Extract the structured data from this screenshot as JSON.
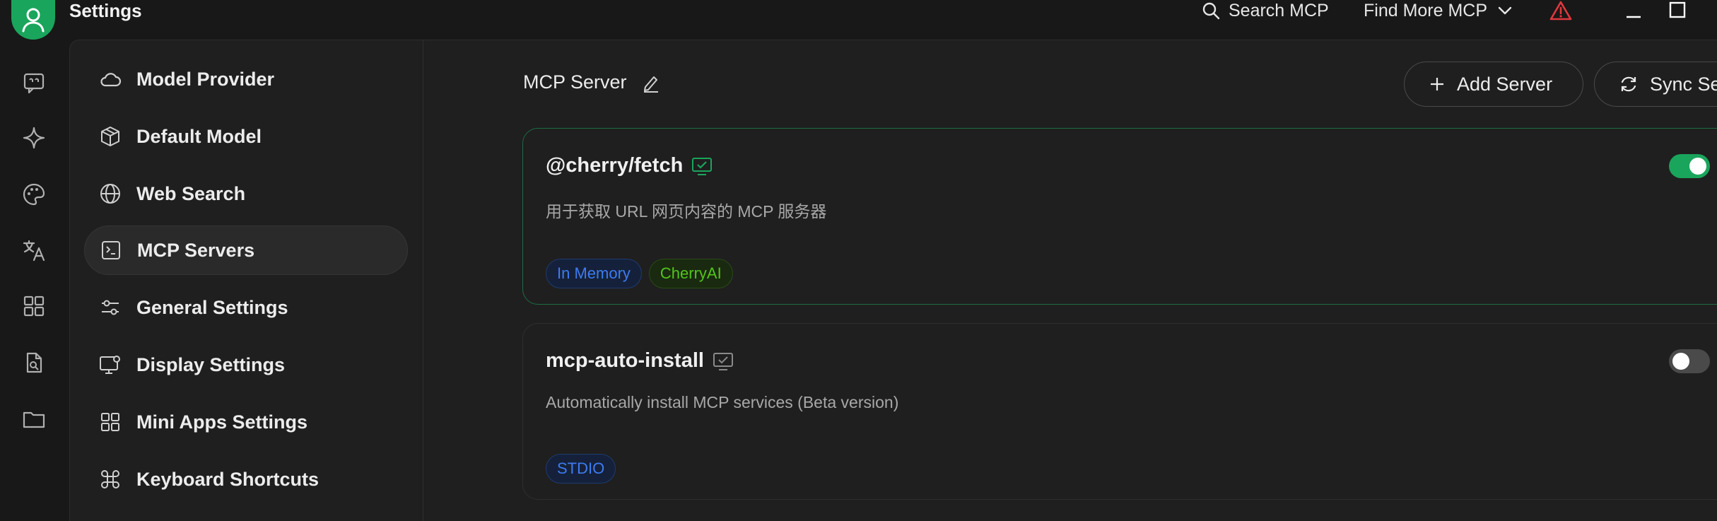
{
  "window": {
    "title": "Settings"
  },
  "topbar": {
    "search_label": "Search MCP",
    "find_more_label": "Find More MCP"
  },
  "rail": {
    "icons": [
      "chat-icon",
      "sparkle-icon",
      "palette-icon",
      "translate-icon",
      "apps-icon",
      "file-search-icon",
      "folder-icon"
    ]
  },
  "nav": {
    "items": [
      {
        "label": "Model Provider",
        "icon": "cloud-icon"
      },
      {
        "label": "Default Model",
        "icon": "cube-icon"
      },
      {
        "label": "Web Search",
        "icon": "globe-icon"
      },
      {
        "label": "MCP Servers",
        "icon": "terminal-icon",
        "active": true
      },
      {
        "label": "General Settings",
        "icon": "sliders-icon"
      },
      {
        "label": "Display Settings",
        "icon": "monitor-gear-icon"
      },
      {
        "label": "Mini Apps Settings",
        "icon": "grid-icon"
      },
      {
        "label": "Keyboard Shortcuts",
        "icon": "command-icon"
      }
    ]
  },
  "main": {
    "title": "MCP Server",
    "add_button": "Add Server",
    "sync_button": "Sync Servers",
    "servers": [
      {
        "name": "@cherry/fetch",
        "description": "用于获取 URL 网页内容的 MCP 服务器",
        "enabled": true,
        "tags": [
          "In Memory",
          "CherryAI"
        ]
      },
      {
        "name": "mcp-auto-install",
        "description": "Automatically install MCP services (Beta version)",
        "enabled": false,
        "tags": [
          "STDIO"
        ]
      }
    ]
  },
  "colors": {
    "accent_green": "#1aa55c",
    "tag_blue": "#3d7bf0",
    "tag_green": "#52c41a",
    "warning_red": "#e0383e"
  }
}
